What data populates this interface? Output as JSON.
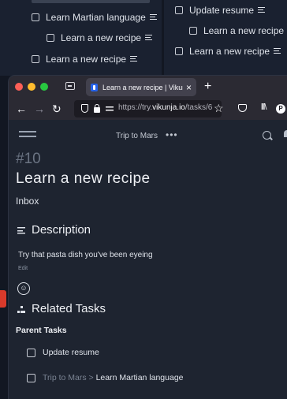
{
  "background": {
    "left_items": [
      {
        "label": "Learn Martian language"
      },
      {
        "label": "Learn a new recipe"
      },
      {
        "label": "Learn a new recipe"
      }
    ],
    "right_items": [
      {
        "label": "Update resume"
      },
      {
        "label": "Learn a new recipe"
      },
      {
        "label": "Learn a new recipe"
      }
    ]
  },
  "browser": {
    "tab_title": "Learn a new recipe | Vikunja",
    "tab_close": "×",
    "new_tab": "+",
    "url_prefix": "https://try.",
    "url_domain": "vikunja.io",
    "url_path": "/tasks/6",
    "back": "←",
    "forward": "→",
    "reload": "↻",
    "star": "☆",
    "library": "lll\\",
    "profile_letter": "P"
  },
  "app": {
    "project_name": "Trip to Mars",
    "menu_dots": "•••",
    "task_number": "#10",
    "task_title": "Learn a new recipe",
    "project_label": "Inbox",
    "description_heading": "Description",
    "description_text": "Try that pasta dish you've been eyeing",
    "edit_label": "Edit",
    "emoji_icon": "☺",
    "related_heading": "Related Tasks",
    "parent_tasks_label": "Parent Tasks",
    "parent_tasks": [
      {
        "project": "",
        "separator": "",
        "title": "Update resume"
      },
      {
        "project": "Trip to Mars",
        "separator": " > ",
        "title": "Learn Martian language"
      }
    ]
  },
  "colors": {
    "background": "#121722",
    "window": "#1e2430",
    "browser_chrome": "#2b2a33",
    "active_tab": "#42414d",
    "favicon": "#2563eb",
    "accent_red": "#d93a2b"
  }
}
